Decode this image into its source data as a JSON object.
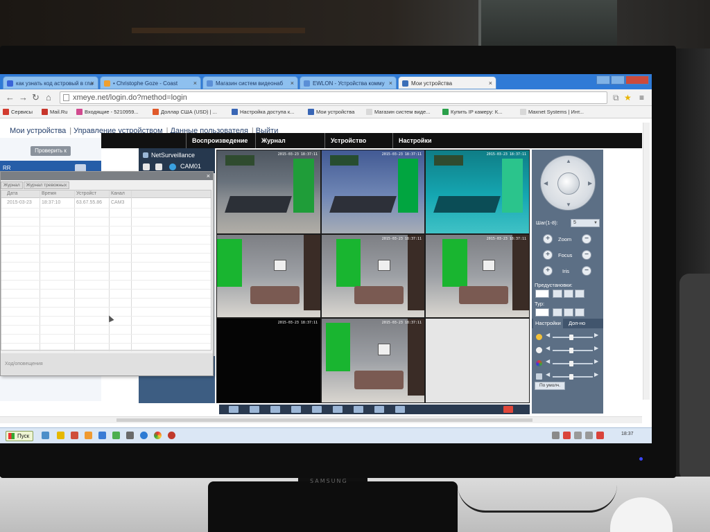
{
  "monitor": {
    "brand": "SAMSUNG"
  },
  "browser": {
    "tabs": [
      {
        "label": "как узнать код астровый в гла",
        "icon_color": "#3a64d8"
      },
      {
        "label": "• Christophe Goze - Coast",
        "icon_color": "#f0a030"
      },
      {
        "label": "Магазин систем видеонаб",
        "icon_color": "#5b8fd6"
      },
      {
        "label": "EWLON - Устройства комму",
        "icon_color": "#5b8fd6"
      },
      {
        "label": "Мои устройства",
        "icon_color": "#3b6fb8"
      }
    ],
    "address": "xmeye.net/login.do?method=login",
    "bookmarks": [
      "Сервисы",
      "Mail.Ru",
      "Входящие - 5210959...",
      "Доллар США (USD) | ...",
      "Настройка доступа к...",
      "Мои устройства",
      "Магазин систем виде...",
      "Купить IP камеру: К...",
      "Maxnet Systems | Инт..."
    ]
  },
  "site": {
    "nav": [
      "Мои устройства",
      "Управление устройством",
      "Данные пользователя",
      "Выйти"
    ],
    "app_menu": [
      "Воспроизведение",
      "Журнал",
      "Устройство",
      "Настройки"
    ],
    "left": {
      "prov_button": "Проверить к",
      "row_label": "RR"
    },
    "tree": {
      "title": "NetSurveillance",
      "camera": "CAM01"
    }
  },
  "log_window": {
    "tabs": [
      "Журнал",
      "Журнал тревожных"
    ],
    "columns": [
      "Дата",
      "Время",
      "Устройст",
      "Канал"
    ],
    "rows": [
      [
        "2015-03-23",
        "18:37:10",
        "63.67.55.86",
        "CAM3"
      ]
    ],
    "footer": "Ход/оповещения"
  },
  "cameras": [
    {
      "kind": "office",
      "variant": "",
      "label": "2015-03-23 18:37:11"
    },
    {
      "kind": "office",
      "variant": "blue",
      "label": "2015-03-23 18:37:11"
    },
    {
      "kind": "office",
      "variant": "cyan",
      "label": "2015-03-23 18:37:11"
    },
    {
      "kind": "lounge",
      "variant": "",
      "label": ""
    },
    {
      "kind": "lounge",
      "variant": "",
      "label": "2015-03-23 18:37:11"
    },
    {
      "kind": "lounge",
      "variant": "",
      "label": "2015-03-23 18:37:11"
    },
    {
      "kind": "black",
      "variant": "",
      "label": "2015-03-23 18:37:11"
    },
    {
      "kind": "lounge",
      "variant": "",
      "label": "2015-03-23 18:37:11"
    },
    {
      "kind": "empty",
      "variant": "",
      "label": ""
    }
  ],
  "ptz": {
    "step_label": "Шаг(1-8):",
    "step_value": "5",
    "zoom": "Zoom",
    "focus": "Focus",
    "iris": "Iris",
    "presets": "Предустановки:",
    "tour": "Тур:",
    "tabs": [
      "Настройки",
      "Доп-но"
    ],
    "default_button": "По умолч."
  },
  "taskbar": {
    "start": "Пуск",
    "clock": "18:37"
  }
}
